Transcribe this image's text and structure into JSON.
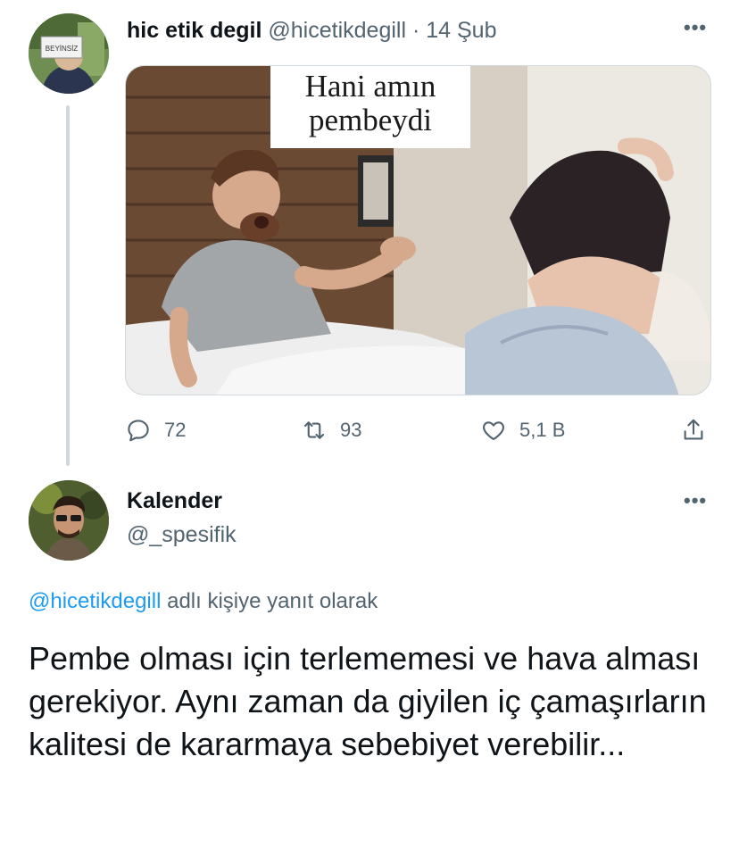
{
  "tweet": {
    "author_name": "hic etik degil",
    "author_handle": "@hicetikdegill",
    "separator": "·",
    "date": "14 Şub",
    "more_label": "•••",
    "avatar_sign_text": "BEYİNSİZ",
    "media_caption_line1": "Hani amın",
    "media_caption_line2": "pembeydi",
    "actions": {
      "reply_icon": "comment-icon",
      "reply_count": "72",
      "retweet_icon": "retweet-icon",
      "retweet_count": "93",
      "like_icon": "heart-icon",
      "like_count": "5,1 B",
      "share_icon": "share-icon"
    }
  },
  "reply": {
    "author_name": "Kalender",
    "author_handle": "@_spesifik",
    "more_label": "•••",
    "replying_mention": "@hicetikdegill",
    "replying_suffix": " adlı kişiye yanıt olarak",
    "text": "Pembe olması için terlememesi ve hava alması gerekiyor. Aynı zaman da giyilen iç çamaşırların kalitesi de kararmaya sebebiyet verebilir..."
  },
  "colors": {
    "text_primary": "#0f1419",
    "text_secondary": "#536471",
    "link": "#1d9bf0",
    "thread_line": "#cfd9de"
  }
}
